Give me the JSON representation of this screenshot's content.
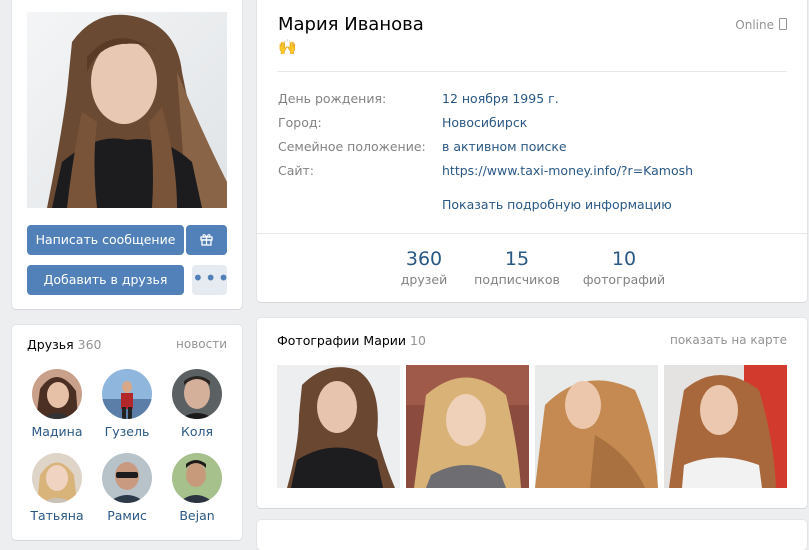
{
  "profile": {
    "name": "Мария Иванова",
    "status_emoji": "🙌",
    "online": "Online",
    "info": [
      {
        "label": "День рождения:",
        "value": "12 ноября 1995 г."
      },
      {
        "label": "Город:",
        "value": "Новосибирск"
      },
      {
        "label": "Семейное положение:",
        "value": "в активном поиске"
      },
      {
        "label": "Сайт:",
        "value": "https://www.taxi-money.info/?r=Kamosh"
      }
    ],
    "show_more": "Показать подробную информацию",
    "counters": [
      {
        "num": "360",
        "label": "друзей"
      },
      {
        "num": "15",
        "label": "подписчиков"
      },
      {
        "num": "10",
        "label": "фотографий"
      }
    ]
  },
  "actions": {
    "message": "Написать сообщение",
    "add_friend": "Добавить в друзья",
    "more": "•••"
  },
  "friends": {
    "title": "Друзья",
    "count": "360",
    "news": "новости",
    "items": [
      {
        "name": "Мадина"
      },
      {
        "name": "Гузель"
      },
      {
        "name": "Коля"
      },
      {
        "name": "Татьяна"
      },
      {
        "name": "Рамис"
      },
      {
        "name": "Bejan"
      }
    ]
  },
  "photos": {
    "title": "Фотографии Марии",
    "count": "10",
    "map_link": "показать на карте"
  }
}
